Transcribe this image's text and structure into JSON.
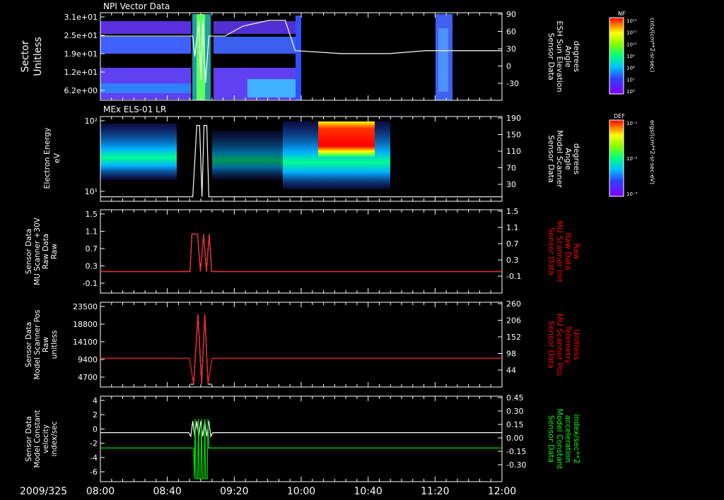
{
  "chart_data": {
    "type": "line",
    "time_axis": {
      "date_label": "2009/325",
      "ticks": [
        "08:00",
        "08:40",
        "09:20",
        "10:00",
        "10:40",
        "11:20",
        "12:00"
      ]
    },
    "panels": [
      {
        "id": "npi",
        "type": "heatmap",
        "title": "NPI Vector Data",
        "ylabel": "Sector",
        "yunit": "Unitless",
        "yticks": [
          "3.1e+01",
          "2.5e+01",
          "1.9e+01",
          "1.2e+01",
          "6.2e+00"
        ],
        "right_label": [
          "Sensor Data",
          "ESH Sun Elevation",
          "Angle",
          "degrees"
        ],
        "right_ticks": [
          "90",
          "60",
          "30",
          "0",
          "-30"
        ],
        "right_label_color": "#ffffff",
        "colorbar": {
          "label": "NF",
          "units": "cnts/(cm**2-sr-sec)",
          "ticks": [
            "10¹²",
            "10¹¹",
            "10¹⁰",
            "10⁹",
            "10⁸",
            "10⁷",
            "10⁶"
          ]
        },
        "overlay_series": {
          "name": "Sensor Data ESH Sun Elevation Angle",
          "color": "#ffffff",
          "points": [
            [
              0,
              55
            ],
            [
              0.23,
              55
            ],
            [
              0.235,
              20
            ],
            [
              0.245,
              80
            ],
            [
              0.25,
              -20
            ],
            [
              0.255,
              80
            ],
            [
              0.262,
              -25
            ],
            [
              0.27,
              55
            ],
            [
              0.31,
              55
            ],
            [
              0.355,
              72
            ],
            [
              0.42,
              82
            ],
            [
              0.46,
              82
            ],
            [
              0.485,
              30
            ],
            [
              0.6,
              25
            ],
            [
              0.72,
              25
            ],
            [
              0.81,
              30
            ],
            [
              0.83,
              30
            ],
            [
              1.0,
              30
            ]
          ]
        }
      },
      {
        "id": "els",
        "type": "heatmap",
        "title": "MEx ELS-01 LR",
        "ylabel": "Electron Energy",
        "yunit": "eV",
        "yticks": [
          "10²",
          "10¹"
        ],
        "right_label": [
          "Sensor Data",
          "Model Scanner",
          "Angle",
          "degrees"
        ],
        "right_ticks": [
          "190",
          "150",
          "110",
          "70",
          "30"
        ],
        "right_label_color": "#ffffff",
        "colorbar": {
          "label": "DEF",
          "units": "ergs/(cm**2-sr-sec-eV)",
          "ticks": [
            "10⁻¹",
            "10⁻²",
            "10⁻³"
          ]
        },
        "overlay_series": {
          "name": "Sensor Data Model Scanner Angle",
          "color": "#ffffff",
          "points": [
            [
              0,
              10
            ],
            [
              0.23,
              10
            ],
            [
              0.24,
              170
            ],
            [
              0.247,
              170
            ],
            [
              0.253,
              10
            ],
            [
              0.258,
              170
            ],
            [
              0.265,
              170
            ],
            [
              0.27,
              10
            ],
            [
              1.0,
              10
            ]
          ]
        }
      },
      {
        "id": "raw",
        "type": "line",
        "ylabel_lines": [
          "Sensor Data",
          "MU Scanner +30V",
          "Raw Data",
          "Raw"
        ],
        "yticks": [
          "1.5",
          "1.1",
          "0.7",
          "0.3",
          "-0.1"
        ],
        "right_label": [
          "Sensor Data",
          "MU Scanner Init",
          "Raw Data",
          "Raw"
        ],
        "right_ticks": [
          "1.5",
          "1.1",
          "0.7",
          "0.3",
          "-0.1"
        ],
        "right_label_color": "#ff0000",
        "ylim": [
          -0.5,
          1.5
        ],
        "series": [
          {
            "name": "Sensor Data MU Scanner +30V Raw Data",
            "color": "#ffffff",
            "x": [
              0,
              0.223,
              0.228,
              0.242,
              0.249,
              0.257,
              0.264,
              0.271,
              0.277,
              1.0
            ],
            "y": [
              0,
              0,
              1,
              1,
              0,
              1,
              0,
              1,
              0,
              0
            ]
          },
          {
            "name": "Sensor Data MU Scanner Init Raw Data",
            "color": "#ff2020",
            "x": [
              0,
              0.223,
              0.228,
              0.242,
              0.249,
              0.257,
              0.264,
              0.271,
              0.277,
              1.0
            ],
            "y": [
              0,
              0,
              1,
              1,
              0,
              1,
              0,
              1,
              0,
              0
            ]
          }
        ]
      },
      {
        "id": "pos",
        "type": "line",
        "ylabel_lines": [
          "Sensor Data",
          "Model Scanner Pos",
          "Raw",
          "unitless"
        ],
        "yticks": [
          "23500",
          "18800",
          "14100",
          "9400",
          "4700"
        ],
        "right_label": [
          "Sensor Data",
          "MU Scanner Pos",
          "Telemetry",
          "Unitless"
        ],
        "right_ticks": [
          "260",
          "206",
          "152",
          "98",
          "44"
        ],
        "right_label_color": "#ff0000",
        "ylim": [
          0,
          23500
        ],
        "series": [
          {
            "name": "Sensor Data Model Scanner Pos Raw",
            "color": "#ffffff",
            "x": [
              0.225,
              0.232,
              0.243,
              0.252,
              0.26,
              0.268,
              0.276
            ],
            "y": [
              0,
              0,
              21500,
              0,
              21500,
              0,
              0
            ]
          },
          {
            "name": "Sensor Data MU Scanner Pos Telemetry",
            "color": "#ff2020",
            "x": [
              0,
              0.222,
              0.232,
              0.243,
              0.252,
              0.26,
              0.268,
              0.278,
              1.0
            ],
            "y": [
              8000,
              8000,
              0,
              21500,
              0,
              21500,
              0,
              8000,
              8000
            ]
          }
        ]
      },
      {
        "id": "vel",
        "type": "line",
        "ylabel_lines": [
          "Sensor Data",
          "Model Constant",
          "velocity",
          "index/sec"
        ],
        "yticks": [
          "4",
          "2",
          "0",
          "-2",
          "-4",
          "-6"
        ],
        "right_label": [
          "Sensor Data",
          "Model Constant",
          "acceleration",
          "index/sec**2"
        ],
        "right_ticks": [
          "0.45",
          "0.30",
          "0.15",
          "0.00",
          "-0.15",
          "-0.30"
        ],
        "right_label_color": "#00ff00",
        "ylim": [
          -6,
          4
        ],
        "series": [
          {
            "name": "Sensor Data Model Constant velocity",
            "color": "#ffffff",
            "x": [
              0,
              0.22,
              0.225,
              0.23,
              0.235,
              0.24,
              0.245,
              0.25,
              0.255,
              0.26,
              0.265,
              0.27,
              0.275,
              0.28,
              1.0
            ],
            "y": [
              0,
              0,
              -0.5,
              1.5,
              -0.5,
              1.5,
              -0.5,
              1.5,
              -0.5,
              1.5,
              -0.5,
              1.5,
              -0.5,
              0,
              0
            ]
          },
          {
            "name": "Sensor Data Model Constant acceleration",
            "color": "#00dd00",
            "x": [
              0,
              0.232,
              0.234,
              0.236,
              0.238,
              0.242,
              0.244,
              0.246,
              0.25,
              0.252,
              0.254,
              0.258,
              0.26,
              0.262,
              0.266,
              0.268,
              0.27,
              1.0
            ],
            "y": [
              -2,
              -2,
              -6,
              1.8,
              -6,
              -6,
              1.8,
              -6,
              -6,
              1.8,
              -6,
              -6,
              1.8,
              -6,
              -6,
              1.8,
              -2,
              -2
            ]
          }
        ]
      }
    ]
  }
}
